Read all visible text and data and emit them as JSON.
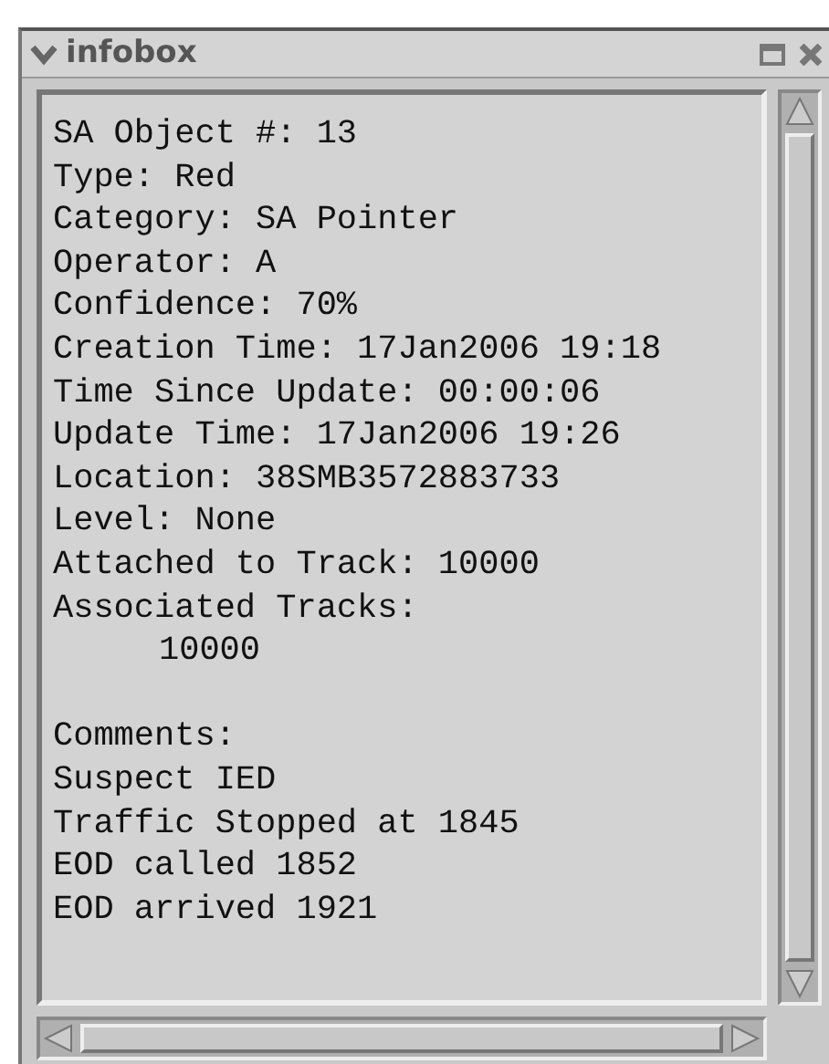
{
  "window": {
    "title": "infobox"
  },
  "lines": [
    {
      "kind": "text",
      "text": "SA Object #: 13"
    },
    {
      "kind": "text",
      "text": "Type: Red"
    },
    {
      "kind": "text",
      "text": "Category: SA Pointer"
    },
    {
      "kind": "text",
      "text": "Operator: A"
    },
    {
      "kind": "text",
      "text": "Confidence: 70%"
    },
    {
      "kind": "text",
      "text": "Creation Time: 17Jan2006 19:18"
    },
    {
      "kind": "text",
      "text": "Time Since Update: 00:00:06"
    },
    {
      "kind": "text",
      "text": "Update Time: 17Jan2006 19:26"
    },
    {
      "kind": "text",
      "text": "Location: 38SMB3572883733"
    },
    {
      "kind": "text",
      "text": "Level: None"
    },
    {
      "kind": "text",
      "text": "Attached to Track: 10000"
    },
    {
      "kind": "text",
      "text": "Associated Tracks:"
    },
    {
      "kind": "indented",
      "text": "10000"
    },
    {
      "kind": "blank"
    },
    {
      "kind": "text",
      "text": "Comments:"
    },
    {
      "kind": "text",
      "text": "Suspect IED"
    },
    {
      "kind": "text",
      "text": "Traffic Stopped at 1845"
    },
    {
      "kind": "text",
      "text": "EOD called 1852"
    },
    {
      "kind": "text",
      "text": "EOD arrived 1921"
    }
  ]
}
